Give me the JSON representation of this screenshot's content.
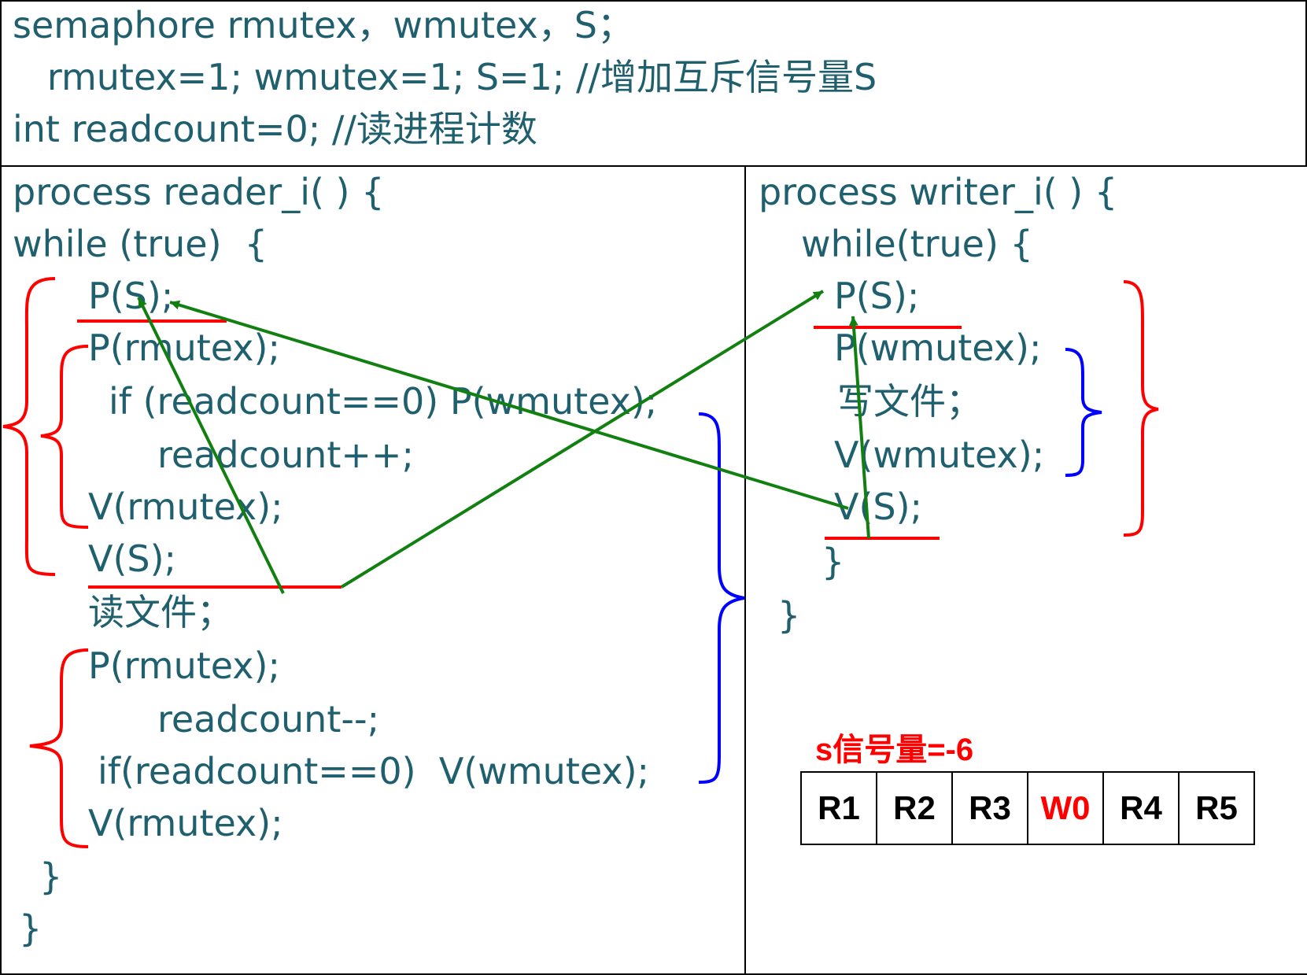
{
  "declarations": {
    "line1": "semaphore rmutex，wmutex，S；",
    "line2": "   rmutex=1; wmutex=1; S=1; //增加互斥信号量S",
    "line3": "int readcount=0; //读进程计数"
  },
  "reader": {
    "header": "process reader_i( ) {",
    "while_line": "while (true)  {",
    "lines": [
      "P(S);",
      "P(rmutex);",
      "if (readcount==0) P(wmutex);",
      "readcount++;",
      "V(rmutex);",
      "V(S);",
      "读文件；",
      "P(rmutex);",
      "readcount--;",
      "if(readcount==0)  V(wmutex);",
      "V(rmutex);"
    ],
    "close_inner": "}",
    "close_outer": "}"
  },
  "writer": {
    "header": "process writer_i( ) {",
    "while_line": "while(true) {",
    "lines": [
      "P(S);",
      "P(wmutex);",
      "写文件；",
      "V(wmutex);",
      "V(S);"
    ],
    "close_inner": "}",
    "close_outer": "}"
  },
  "semaphore_status": "s信号量=-6",
  "queue": [
    {
      "label": "R1",
      "kind": "reader"
    },
    {
      "label": "R2",
      "kind": "reader"
    },
    {
      "label": "R3",
      "kind": "reader"
    },
    {
      "label": "W0",
      "kind": "writer"
    },
    {
      "label": "R4",
      "kind": "reader"
    },
    {
      "label": "R5",
      "kind": "reader"
    }
  ],
  "colors": {
    "code_text": "#1f5f6e",
    "bracket_red": "#ff0000",
    "bracket_blue": "#0000ff",
    "arrow_green": "#118011",
    "writer_highlight": "#ff0000"
  }
}
